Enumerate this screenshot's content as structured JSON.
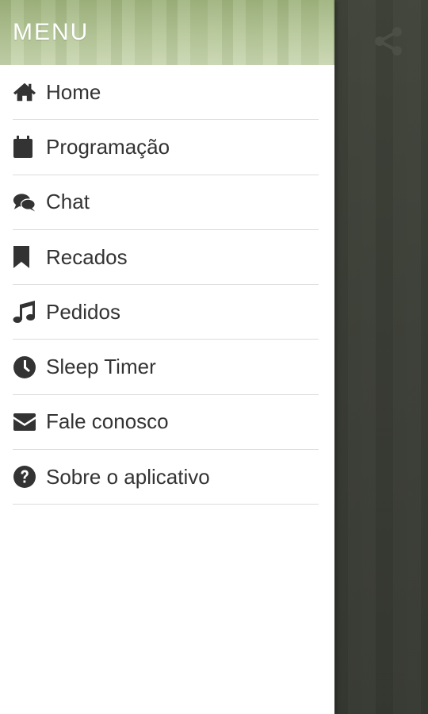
{
  "drawer": {
    "title": "MENU",
    "items": [
      {
        "label": "Home",
        "icon": "home-icon"
      },
      {
        "label": "Programação",
        "icon": "calendar-icon"
      },
      {
        "label": "Chat",
        "icon": "chat-icon"
      },
      {
        "label": "Recados",
        "icon": "bookmark-icon"
      },
      {
        "label": "Pedidos",
        "icon": "music-icon"
      },
      {
        "label": "Sleep Timer",
        "icon": "clock-icon"
      },
      {
        "label": "Fale conosco",
        "icon": "envelope-icon"
      },
      {
        "label": "Sobre o aplicativo",
        "icon": "question-circle-icon"
      }
    ]
  },
  "background": {
    "action_icon": "share-icon"
  },
  "colors": {
    "header_tint": "#b7c89a",
    "overlay": "#3a3d36",
    "icon": "#333333",
    "divider": "#dcdcdc"
  }
}
